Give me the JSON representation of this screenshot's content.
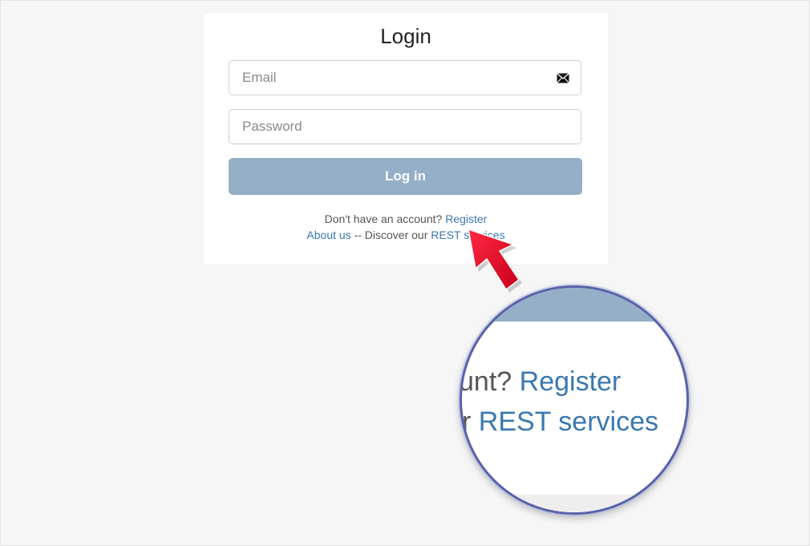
{
  "login": {
    "title": "Login",
    "email_placeholder": "Email",
    "password_placeholder": "Password",
    "login_button": "Log in",
    "no_account_text": "Don't have an account?",
    "register_link": "Register",
    "about_link": "About us",
    "separator_text": "-- Discover our",
    "rest_link": "REST services"
  },
  "magnifier": {
    "line1_prefix": "unt?",
    "line1_link": "Register",
    "line2_prefix": "r",
    "line2_link": "REST services"
  },
  "icons": {
    "email": "envelope-icon",
    "pointer": "red-arrow-pointer"
  },
  "colors": {
    "button": "#95afc8",
    "link": "#3a78b0",
    "arrow": "#e8102a",
    "magnifier_border": "#5962a8"
  }
}
